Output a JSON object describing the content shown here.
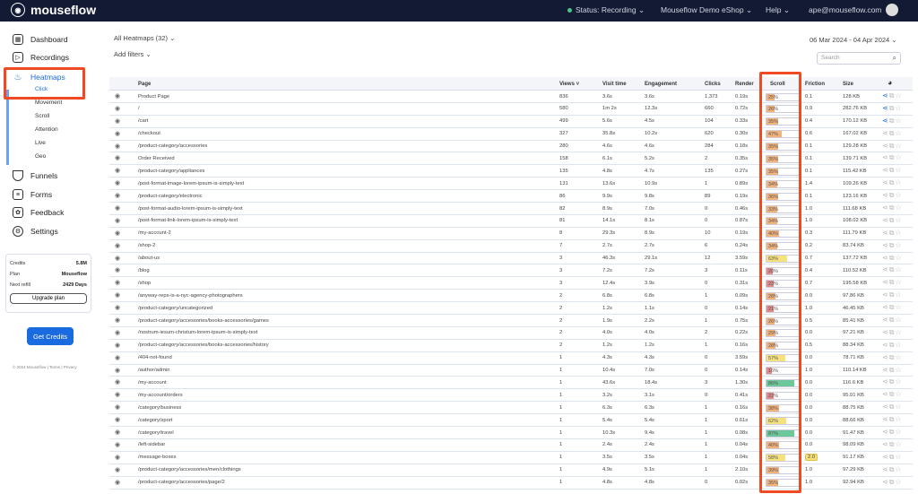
{
  "topbar": {
    "brand": "mouseflow",
    "status": "Status: Recording",
    "site": "Mouseflow Demo eShop",
    "help": "Help",
    "user": "ape@mouseflow.com"
  },
  "sidebar": {
    "items": [
      {
        "label": "Dashboard",
        "icon": "grid-icon"
      },
      {
        "label": "Recordings",
        "icon": "play-icon"
      },
      {
        "label": "Heatmaps",
        "icon": "flame-icon"
      },
      {
        "label": "Funnels",
        "icon": "funnel-icon"
      },
      {
        "label": "Forms",
        "icon": "form-icon"
      },
      {
        "label": "Feedback",
        "icon": "feedback-icon"
      },
      {
        "label": "Settings",
        "icon": "gear-icon"
      }
    ],
    "heatmap_sub": [
      "Click",
      "Movement",
      "Scroll",
      "Attention",
      "Live",
      "Geo"
    ],
    "credits": {
      "credits_label": "Credits",
      "credits_value": "5.8M",
      "plan_label": "Plan",
      "plan_value": "Mouseflow",
      "refill_label": "Next refill",
      "refill_value": "2429 Days",
      "upgrade": "Upgrade plan"
    },
    "get_credits": "Get Credits",
    "footer": "© 2024 Mouseflow  |  Terms  |  Privacy"
  },
  "main": {
    "heatmap_select": "All Heatmaps (32) ⌄",
    "filters": "Add filters ⌄",
    "date_range": "06 Mar 2024 - 04 Apr 2024 ⌄",
    "search_placeholder": "Search"
  },
  "scroll_colors": {
    "low": "#e08a8a",
    "mid": "#f2b27c",
    "high": "#f5e27e",
    "top": "#6cc79a"
  },
  "table": {
    "headers": {
      "page": "Page",
      "views": "Views ˅",
      "visit": "Visit time",
      "engagement": "Engagement",
      "clicks": "Clicks",
      "render": "Render",
      "scroll": "Scroll",
      "friction": "Friction",
      "size": "Size"
    },
    "rows": [
      [
        "Product Page",
        "836",
        "3.6s",
        "3.6s",
        "1,373",
        "0.19s",
        25,
        "0.1",
        "128 KB",
        true
      ],
      [
        "/",
        "580",
        "1m 2s",
        "12.3s",
        "660",
        "0.72s",
        26,
        "0.9",
        "282.76 KB",
        true
      ],
      [
        "/cart",
        "499",
        "5.6s",
        "4.5s",
        "104",
        "0.33s",
        35,
        "0.4",
        "170.12 KB",
        true
      ],
      [
        "/checkout",
        "327",
        "35.8s",
        "10.2s",
        "620",
        "0.30s",
        47,
        "0.6",
        "167.02 KB",
        false
      ],
      [
        "/product-category/accessories",
        "280",
        "4.6s",
        "4.6s",
        "284",
        "0.18s",
        35,
        "0.1",
        "129.28 KB",
        false
      ],
      [
        "Order Received",
        "158",
        "6.1s",
        "5.2s",
        "2",
        "0.35s",
        35,
        "0.1",
        "139.71 KB",
        false
      ],
      [
        "/product-category/appliances",
        "135",
        "4.8s",
        "4.7s",
        "135",
        "0.27s",
        35,
        "0.1",
        "115.42 KB",
        false
      ],
      [
        "/post-format-image-lorem-ipsum-is-simply-text",
        "131",
        "13.6s",
        "10.9s",
        "1",
        "0.89s",
        34,
        "1.4",
        "109.26 KB",
        false
      ],
      [
        "/product-category/electronic",
        "86",
        "9.9s",
        "9.8s",
        "89",
        "0.19s",
        36,
        "0.1",
        "123.16 KB",
        false
      ],
      [
        "/post-format-audio-lorem-ipsum-is-simply-text",
        "82",
        "8.9s",
        "7.0s",
        "0",
        "0.46s",
        33,
        "1.0",
        "111.68 KB",
        false
      ],
      [
        "/post-format-link-lorem-ipsum-is-simply-text",
        "81",
        "14.1s",
        "8.1s",
        "0",
        "0.87s",
        34,
        "1.0",
        "108.02 KB",
        false
      ],
      [
        "/my-account-2",
        "8",
        "29.3s",
        "8.9s",
        "10",
        "0.19s",
        40,
        "0.3",
        "111.79 KB",
        false
      ],
      [
        "/shop-2",
        "7",
        "2.7s",
        "2.7s",
        "6",
        "0.24s",
        34,
        "0.2",
        "83.74 KB",
        false
      ],
      [
        "/about-us",
        "3",
        "46.3s",
        "29.1s",
        "12",
        "3.59s",
        63,
        "0.7",
        "137.72 KB",
        false
      ],
      [
        "/blog",
        "3",
        "7.2s",
        "7.2s",
        "3",
        "0.11s",
        20,
        "0.4",
        "110.52 KB",
        false
      ],
      [
        "/shop",
        "3",
        "12.4s",
        "3.9s",
        "0",
        "0.31s",
        23,
        "0.7",
        "195.58 KB",
        false
      ],
      [
        "/anyway-reps-is-a-nyc-agency-photographers",
        "2",
        "6.8s",
        "6.8s",
        "1",
        "0.09s",
        28,
        "0.0",
        "97.86 KB",
        false
      ],
      [
        "/product-category/uncategorized",
        "2",
        "1.2s",
        "1.1s",
        "0",
        "0.14s",
        21,
        "1.0",
        "46.45 KB",
        false
      ],
      [
        "/product-category/accessories/books-accessories/games",
        "2",
        "1.9s",
        "2.2s",
        "1",
        "0.75s",
        26,
        "0.5",
        "85.41 KB",
        false
      ],
      [
        "/nostrum-iesum-christum-lorem-ipsum-is-simply-text",
        "2",
        "4.0s",
        "4.0s",
        "2",
        "0.22s",
        29,
        "0.0",
        "97.21 KB",
        false
      ],
      [
        "/product-category/accessories/books-accessories/history",
        "2",
        "1.2s",
        "1.2s",
        "1",
        "0.16s",
        28,
        "0.5",
        "88.34 KB",
        false
      ],
      [
        "/404-not-found",
        "1",
        "4.3s",
        "4.3s",
        "0",
        "3.59s",
        57,
        "0.0",
        "78.71 KB",
        false
      ],
      [
        "/author/admin",
        "1",
        "10.4s",
        "7.0s",
        "0",
        "0.14s",
        16,
        "1.0",
        "110.14 KB",
        false
      ],
      [
        "/my-account",
        "1",
        "43.6s",
        "18.4s",
        "3",
        "1.30s",
        86,
        "0.0",
        "116.6 KB",
        false
      ],
      [
        "/my-account/orders",
        "1",
        "3.2s",
        "3.1s",
        "0",
        "0.41s",
        22,
        "0.0",
        "95.01 KB",
        false
      ],
      [
        "/category/business",
        "1",
        "6.3s",
        "6.3s",
        "1",
        "0.16s",
        38,
        "0.0",
        "88.75 KB",
        false
      ],
      [
        "/category/sport",
        "1",
        "5.4s",
        "5.4s",
        "1",
        "0.61s",
        62,
        "0.0",
        "88.66 KB",
        false
      ],
      [
        "/category/travel",
        "1",
        "10.3s",
        "9.4s",
        "1",
        "0.08s",
        87,
        "0.0",
        "91.47 KB",
        false
      ],
      [
        "/left-sidebar",
        "1",
        "2.4s",
        "2.4s",
        "1",
        "0.04s",
        40,
        "0.0",
        "98.09 KB",
        false
      ],
      [
        "/message-boxes",
        "1",
        "3.5s",
        "3.5s",
        "1",
        "0.04s",
        58,
        "2.0",
        "91.17 KB",
        false
      ],
      [
        "/product-category/accessories/men/clothings",
        "1",
        "4.9s",
        "5.1s",
        "1",
        "2.10s",
        39,
        "1.0",
        "97.29 KB",
        false
      ],
      [
        "/product-category/accessories/page/2",
        "1",
        "4.8s",
        "4.8s",
        "0",
        "0.02s",
        35,
        "1.0",
        "92.94 KB",
        false
      ]
    ]
  }
}
